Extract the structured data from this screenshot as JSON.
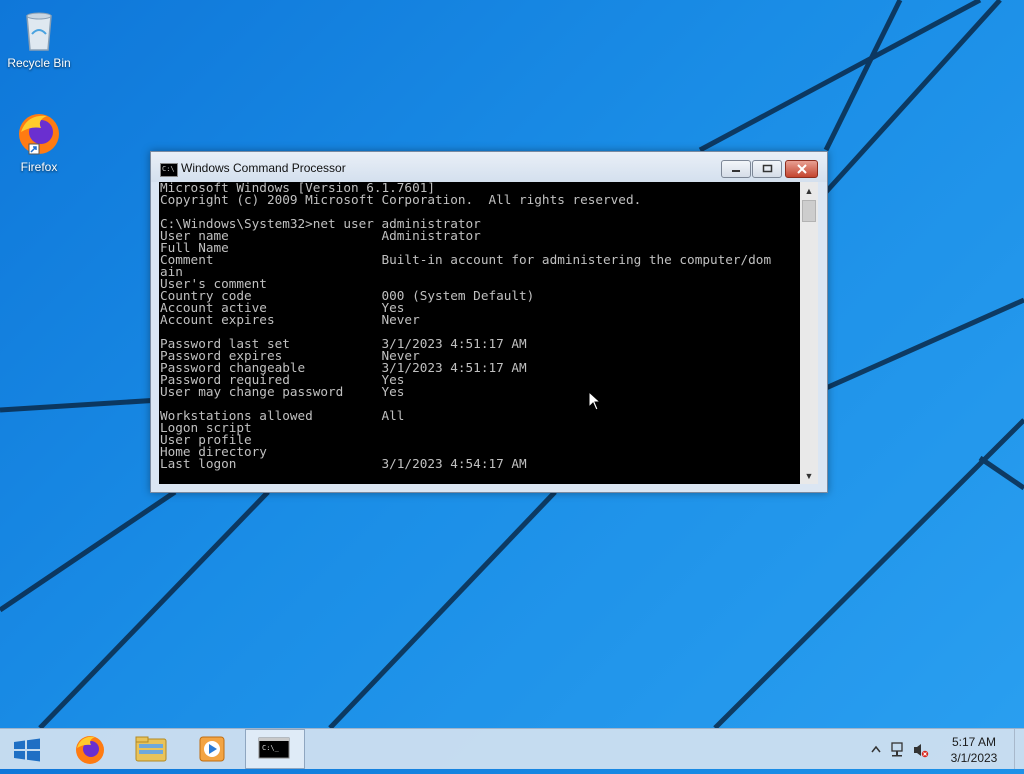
{
  "desktop": {
    "icons": [
      {
        "label": "Recycle Bin",
        "icon": "recycle-bin-icon"
      },
      {
        "label": "Firefox",
        "icon": "firefox-icon"
      }
    ]
  },
  "window": {
    "title": "Windows Command Processor",
    "console_text": "Microsoft Windows [Version 6.1.7601]\nCopyright (c) 2009 Microsoft Corporation.  All rights reserved.\n\nC:\\Windows\\System32>net user administrator\nUser name                    Administrator\nFull Name\nComment                      Built-in account for administering the computer/dom\nain\nUser's comment\nCountry code                 000 (System Default)\nAccount active               Yes\nAccount expires              Never\n\nPassword last set            3/1/2023 4:51:17 AM\nPassword expires             Never\nPassword changeable          3/1/2023 4:51:17 AM\nPassword required            Yes\nUser may change password     Yes\n\nWorkstations allowed         All\nLogon script\nUser profile\nHome directory\nLast logon                   3/1/2023 4:54:17 AM"
  },
  "taskbar": {
    "clock_time": "5:17 AM",
    "clock_date": "3/1/2023"
  },
  "colors": {
    "console_bg": "#000000",
    "console_text": "#c0c0c0",
    "close_button": "#c4452f"
  }
}
